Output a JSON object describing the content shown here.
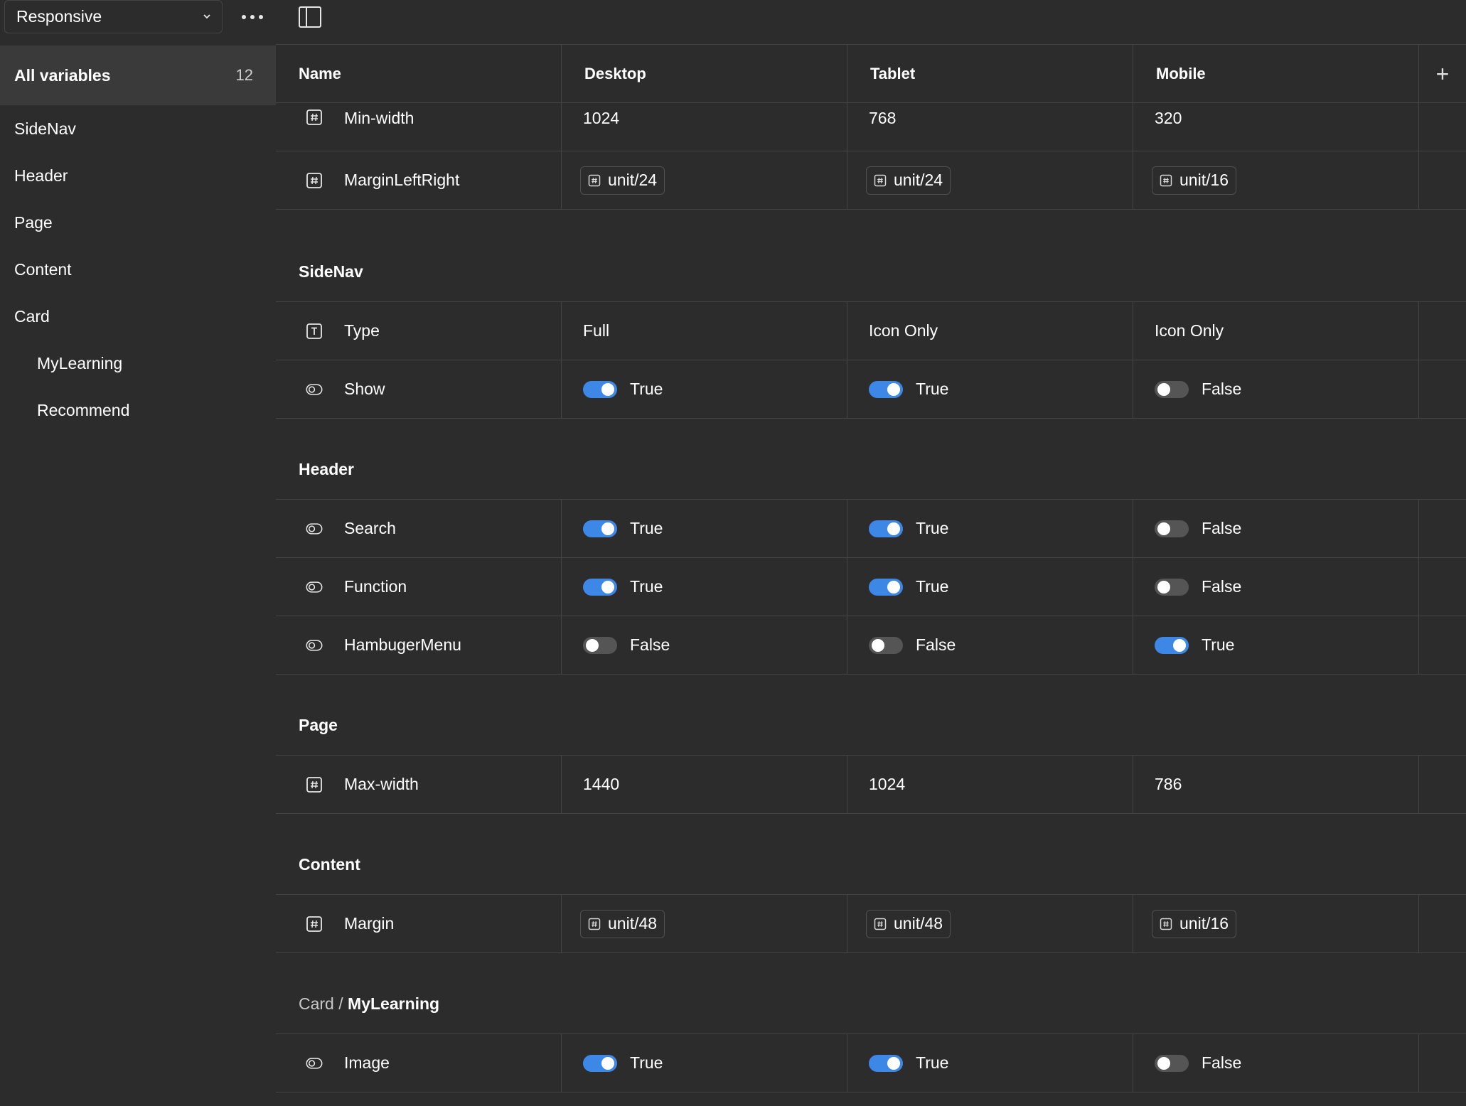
{
  "sidebar": {
    "collection": "Responsive",
    "all_variables_label": "All variables",
    "all_variables_count": "12",
    "groups": [
      {
        "label": "SideNav",
        "indent": false
      },
      {
        "label": "Header",
        "indent": false
      },
      {
        "label": "Page",
        "indent": false
      },
      {
        "label": "Content",
        "indent": false
      },
      {
        "label": "Card",
        "indent": false
      },
      {
        "label": "MyLearning",
        "indent": true
      },
      {
        "label": "Recommend",
        "indent": true
      }
    ]
  },
  "table": {
    "columns": [
      "Name",
      "Desktop",
      "Tablet",
      "Mobile"
    ],
    "sections": [
      {
        "title": "",
        "rows": [
          {
            "name": "Min-width",
            "icon": "number-icon",
            "kind": "number",
            "values": [
              "1024",
              "768",
              "320"
            ]
          },
          {
            "name": "MarginLeftRight",
            "icon": "number-icon",
            "kind": "alias",
            "values": [
              "unit/24",
              "unit/24",
              "unit/16"
            ]
          }
        ]
      },
      {
        "title": "SideNav",
        "rows": [
          {
            "name": "Type",
            "icon": "text-icon",
            "kind": "string",
            "values": [
              "Full",
              "Icon Only",
              "Icon Only"
            ]
          },
          {
            "name": "Show",
            "icon": "boolean-icon",
            "kind": "boolean",
            "values": [
              "True",
              "True",
              "False"
            ]
          }
        ]
      },
      {
        "title": "Header",
        "rows": [
          {
            "name": "Search",
            "icon": "boolean-icon",
            "kind": "boolean",
            "values": [
              "True",
              "True",
              "False"
            ]
          },
          {
            "name": "Function",
            "icon": "boolean-icon",
            "kind": "boolean",
            "values": [
              "True",
              "True",
              "False"
            ]
          },
          {
            "name": "HambugerMenu",
            "icon": "boolean-icon",
            "kind": "boolean",
            "values": [
              "False",
              "False",
              "True"
            ]
          }
        ]
      },
      {
        "title": "Page",
        "rows": [
          {
            "name": "Max-width",
            "icon": "number-icon",
            "kind": "number",
            "values": [
              "1440",
              "1024",
              "786"
            ]
          }
        ]
      },
      {
        "title": "Content",
        "rows": [
          {
            "name": "Margin",
            "icon": "number-icon",
            "kind": "alias",
            "values": [
              "unit/48",
              "unit/48",
              "unit/16"
            ]
          }
        ]
      },
      {
        "title": "MyLearning",
        "title_prefix": "Card / ",
        "rows": [
          {
            "name": "Image",
            "icon": "boolean-icon",
            "kind": "boolean",
            "values": [
              "True",
              "True",
              "False"
            ]
          }
        ]
      }
    ]
  },
  "colors": {
    "background": "#2c2c2c",
    "selected": "#3a3a3a",
    "border": "#444444",
    "toggle_on": "#3d87e6",
    "toggle_off": "#555555"
  }
}
